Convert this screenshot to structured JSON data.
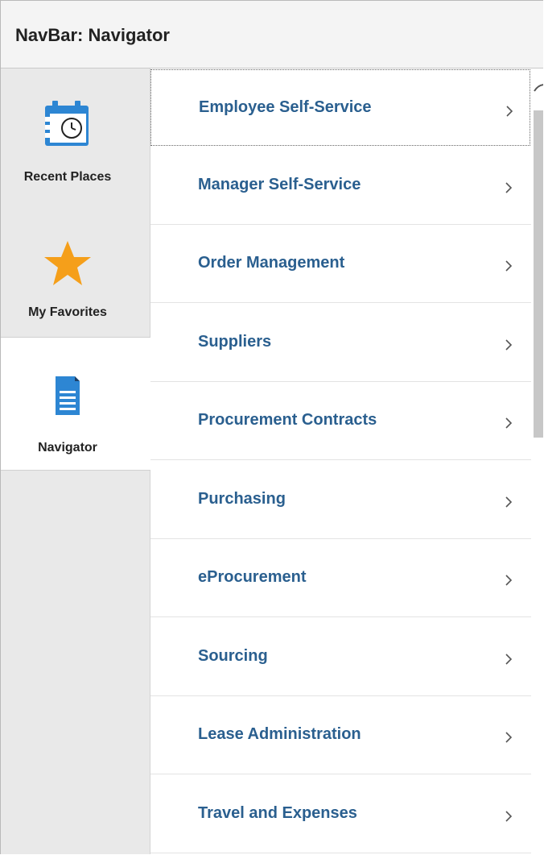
{
  "header": {
    "title": "NavBar: Navigator"
  },
  "sidebar": {
    "tabs": [
      {
        "label": "Recent Places",
        "icon": "calendar-clock-icon",
        "active": false
      },
      {
        "label": "My Favorites",
        "icon": "star-icon",
        "active": false
      },
      {
        "label": "Navigator",
        "icon": "document-icon",
        "active": true
      }
    ]
  },
  "menu": {
    "items": [
      {
        "label": "Employee Self-Service"
      },
      {
        "label": "Manager Self-Service"
      },
      {
        "label": "Order Management"
      },
      {
        "label": "Suppliers"
      },
      {
        "label": "Procurement Contracts"
      },
      {
        "label": "Purchasing"
      },
      {
        "label": "eProcurement"
      },
      {
        "label": "Sourcing"
      },
      {
        "label": "Lease Administration"
      },
      {
        "label": "Travel and Expenses"
      }
    ],
    "chevron_icon": "chevron-right-icon"
  },
  "colors": {
    "link_blue": "#2a5f8f",
    "icon_blue": "#2d86d3",
    "star_orange": "#f59f1a",
    "sidebar_bg": "#e9e9e9",
    "header_bg": "#f4f4f4"
  }
}
